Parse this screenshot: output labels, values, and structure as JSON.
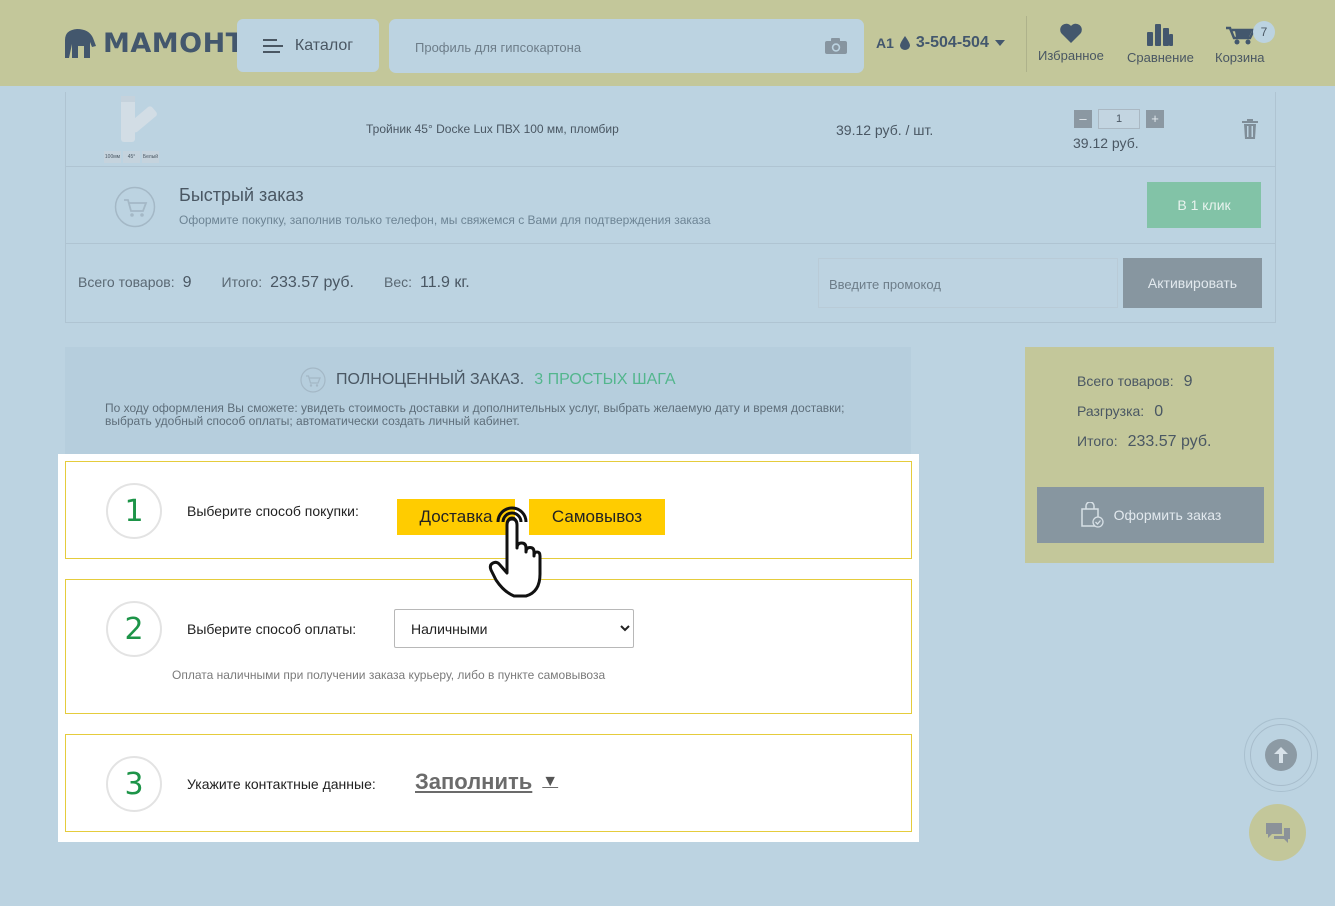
{
  "header": {
    "logo_text": "МАМОНТ",
    "catalog_label": "Каталог",
    "search_placeholder": "Профиль для гипсокартона",
    "operator_badge": "A1",
    "phone": "3-504-504",
    "favorites_label": "Избранное",
    "compare_label": "Сравнение",
    "cart_label": "Корзина",
    "cart_count": "7"
  },
  "cart_item": {
    "name": "Тройник 45° Docke Lux ПВХ 100 мм, пломбир",
    "image_tags": [
      "100мм",
      "45°",
      "Белый"
    ],
    "unit_price": "39.12 руб. / шт.",
    "quantity": "1",
    "minus": "–",
    "plus": "+",
    "line_total": "39.12 руб."
  },
  "quick_order": {
    "title": "Быстрый заказ",
    "description": "Оформите покупку, заполнив только телефон, мы свяжемся с Вами для подтверждения заказа",
    "button": "В 1 клик"
  },
  "totals": {
    "items_label": "Всего товаров:",
    "items_value": "9",
    "total_label": "Итого:",
    "total_value": "233.57 руб.",
    "weight_label": "Вес:",
    "weight_value": "11.9 кг.",
    "promo_placeholder": "Введите промокод",
    "activate_button": "Активировать"
  },
  "full_order": {
    "title": "ПОЛНОЦЕННЫЙ ЗАКАЗ.",
    "subtitle": "3 ПРОСТЫХ ШАГА",
    "description": "По ходу оформления Вы сможете: увидеть стоимость доставки и дополнительных услуг, выбрать желаемую дату и время доставки; выбрать удобный способ оплаты; автоматически создать личный кабинет."
  },
  "summary": {
    "items_label": "Всего товаров:",
    "items_value": "9",
    "unload_label": "Разгрузка:",
    "unload_value": "0",
    "total_label": "Итого:",
    "total_value": "233.57 руб.",
    "checkout_button": "Оформить заказ"
  },
  "steps": [
    {
      "number": "1",
      "label": "Выберите способ покупки:",
      "options": [
        "Доставка",
        "Самовывоз"
      ]
    },
    {
      "number": "2",
      "label": "Выберите способ оплаты:",
      "selected": "Наличными",
      "note": "Оплата наличными при получении заказа курьеру, либо в пункте самовывоза"
    },
    {
      "number": "3",
      "label": "Укажите контактные данные:",
      "link": "Заполнить",
      "arrow": "▼"
    }
  ],
  "colors": {
    "header_bg": "#c3c79a",
    "page_bg": "#bcd3e1",
    "accent_yellow": "#ffcc00",
    "step_green": "#1d9448",
    "quick_btn": "#82c3a7"
  },
  "icons": [
    "mammoth-logo-icon",
    "menu-lines-icon",
    "camera-icon",
    "drop-icon",
    "chevron-down-icon",
    "heart-icon",
    "compare-bottles-icon",
    "wheelbarrow-cart-icon",
    "trash-icon",
    "cart-circle-icon",
    "bag-check-icon",
    "arrow-up-icon",
    "chat-icon",
    "hand-pointer-icon"
  ]
}
